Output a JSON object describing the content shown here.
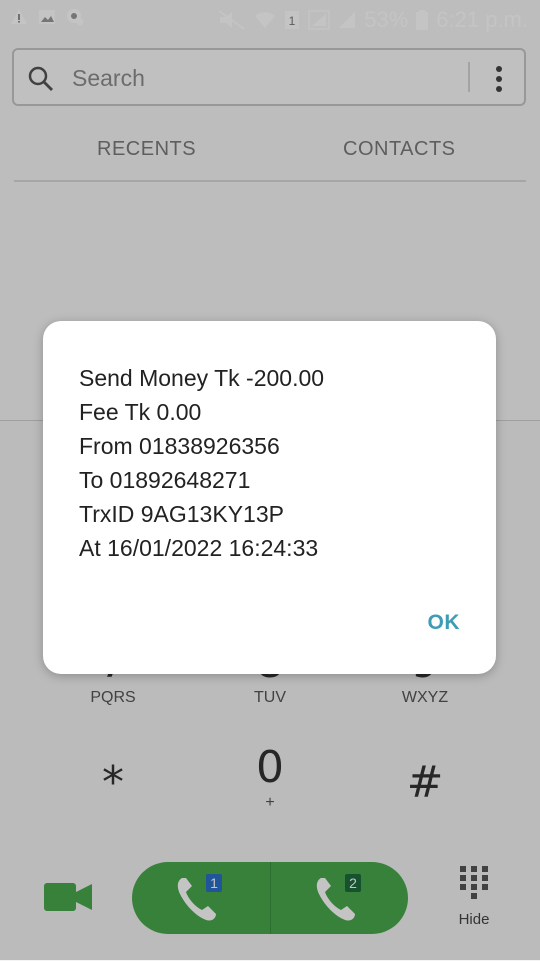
{
  "status_bar": {
    "battery": "53%",
    "time": "6:21 p.m."
  },
  "search": {
    "placeholder": "Search"
  },
  "tabs": {
    "recents": "RECENTS",
    "contacts": "CONTACTS"
  },
  "dialpad": {
    "keys": [
      {
        "num": "7",
        "letters": "PQRS"
      },
      {
        "num": "8",
        "letters": "TUV"
      },
      {
        "num": "9",
        "letters": "WXYZ"
      },
      {
        "num": "*",
        "letters": ""
      },
      {
        "num": "0",
        "letters": "+"
      },
      {
        "num": "#",
        "letters": ""
      }
    ]
  },
  "call_bar": {
    "sim1_label": "1",
    "sim2_label": "2"
  },
  "hide": {
    "label": "Hide"
  },
  "dialog": {
    "lines": [
      "Send Money Tk -200.00",
      "Fee Tk 0.00",
      "From 01838926356",
      "To 01892648271",
      "TrxID 9AG13KY13P",
      "At 16/01/2022 16:24:33"
    ],
    "ok_label": "OK"
  },
  "colors": {
    "call_green": "#4aa84c",
    "dialog_ok": "#3c9db4"
  }
}
